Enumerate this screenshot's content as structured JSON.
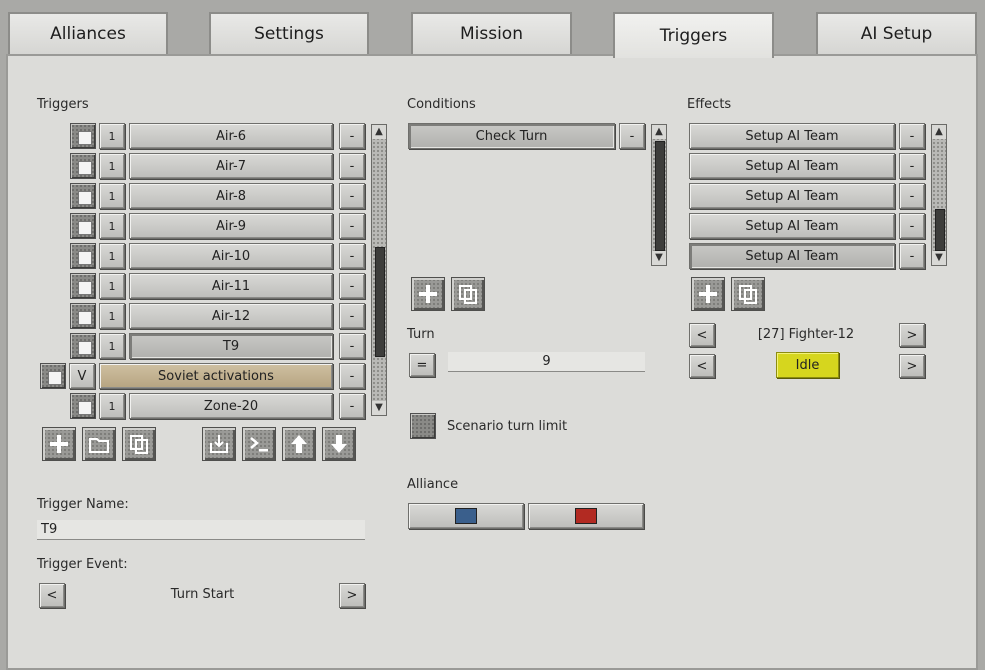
{
  "tabs": [
    {
      "label": "Alliances",
      "active": false
    },
    {
      "label": "Settings",
      "active": false
    },
    {
      "label": "Mission",
      "active": false
    },
    {
      "label": "Triggers",
      "active": true
    },
    {
      "label": "AI Setup",
      "active": false
    }
  ],
  "triggers": {
    "title": "Triggers",
    "items": [
      {
        "num": "1",
        "name": "Air-6"
      },
      {
        "num": "1",
        "name": "Air-7"
      },
      {
        "num": "1",
        "name": "Air-8"
      },
      {
        "num": "1",
        "name": "Air-9"
      },
      {
        "num": "1",
        "name": "Air-10"
      },
      {
        "num": "1",
        "name": "Air-11"
      },
      {
        "num": "1",
        "name": "Air-12"
      },
      {
        "num": "1",
        "name": "T9"
      },
      {
        "num": "V",
        "name": "Soviet activations"
      },
      {
        "num": "1",
        "name": "Zone-20"
      }
    ],
    "remove_label": "-",
    "name_label": "Trigger Name:",
    "name_value": "T9",
    "event_label": "Trigger Event:",
    "event_value": "Turn Start",
    "prev_label": "<",
    "next_label": ">"
  },
  "conditions": {
    "title": "Conditions",
    "items": [
      {
        "name": "Check Turn"
      }
    ],
    "remove_label": "-",
    "turn_label": "Turn",
    "turn_operator": "=",
    "turn_value": "9",
    "scenario_limit_label": "Scenario turn limit",
    "alliance_label": "Alliance",
    "alliance_colors": [
      "#3a5f8c",
      "#b22a22"
    ]
  },
  "effects": {
    "title": "Effects",
    "items": [
      {
        "name": "Setup AI Team"
      },
      {
        "name": "Setup AI Team"
      },
      {
        "name": "Setup AI Team"
      },
      {
        "name": "Setup AI Team"
      },
      {
        "name": "Setup AI Team"
      }
    ],
    "remove_label": "-",
    "team_label": "[27] Fighter-12",
    "state_label": "Idle",
    "prev_label": "<",
    "next_label": ">"
  },
  "icons": [
    "plus-icon",
    "folder-icon",
    "copy-icon",
    "import-icon",
    "console-icon",
    "arrow-up-icon",
    "arrow-down-icon"
  ]
}
